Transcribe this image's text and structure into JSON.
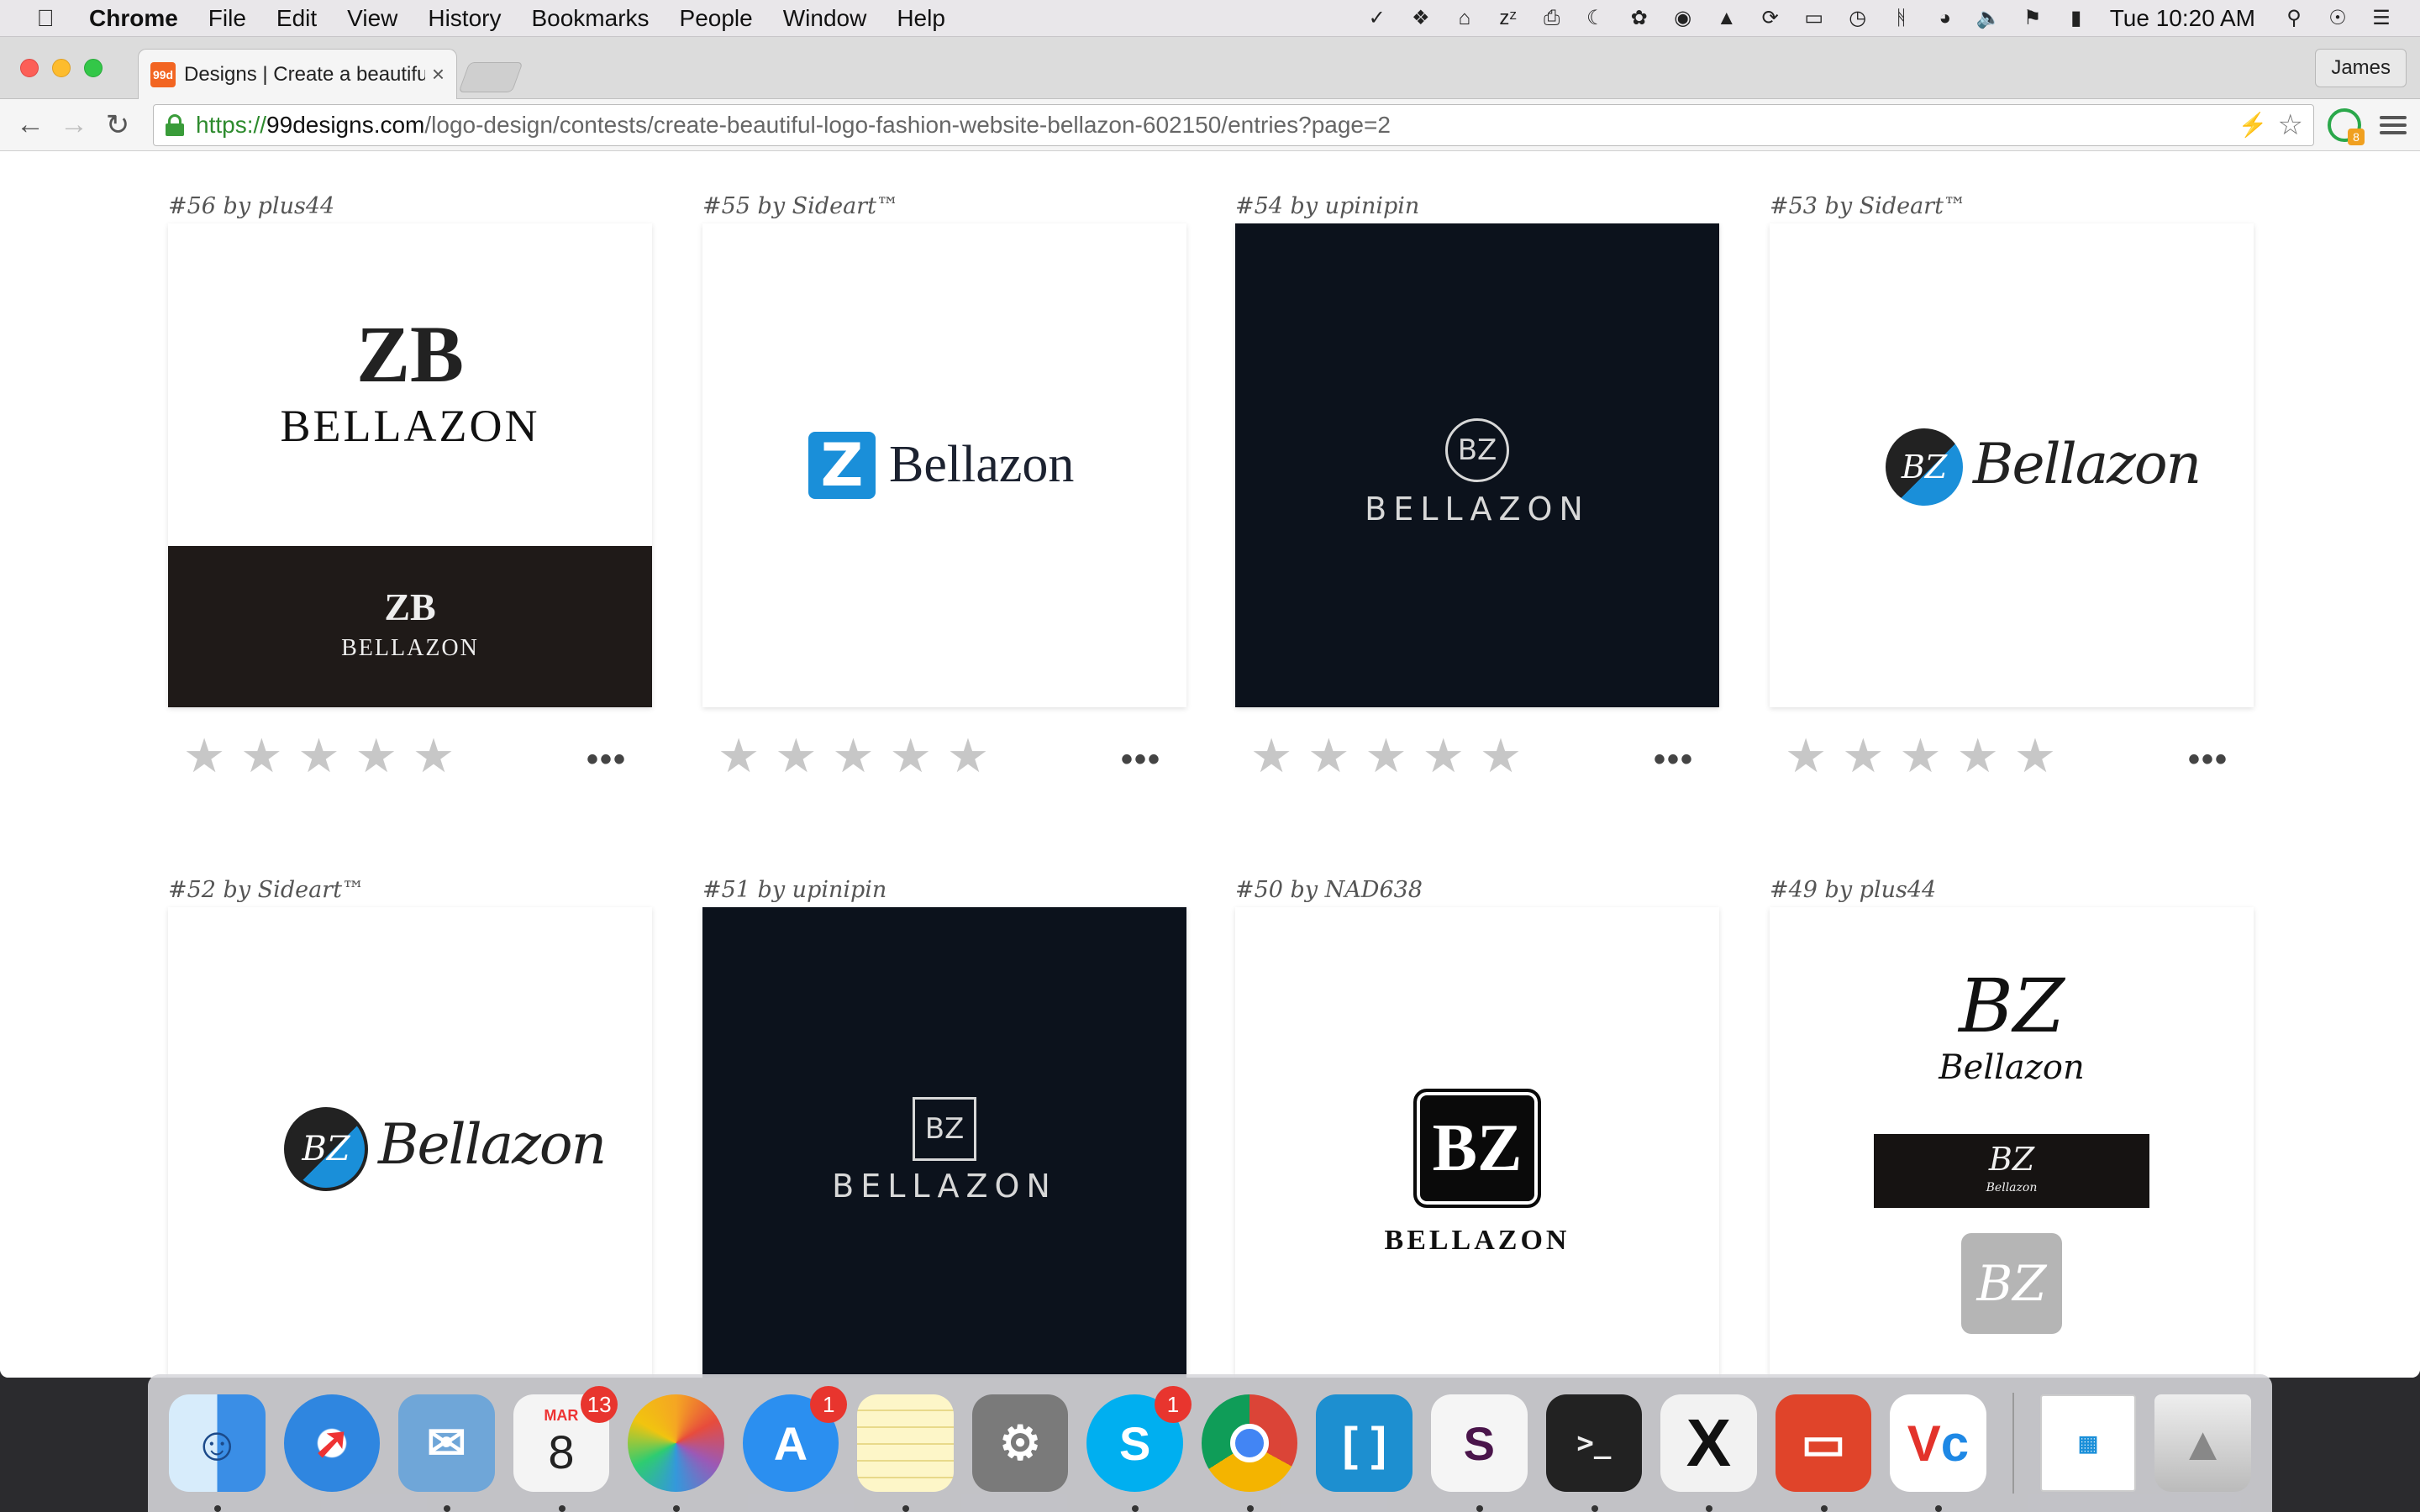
{
  "menubar": {
    "app_name": "Chrome",
    "menus": [
      "File",
      "Edit",
      "View",
      "History",
      "Bookmarks",
      "People",
      "Window",
      "Help"
    ],
    "clock": "Tue 10:20 AM"
  },
  "browser": {
    "tab_title": "Designs | Create a beautifu",
    "tab_favicon": "99d",
    "profile_name": "James",
    "url_scheme": "https://",
    "url_host": "99designs.com",
    "url_path": "/logo-design/contests/create-beautiful-logo-fashion-website-bellazon-602150/entries?page=2",
    "extension_badge": "8"
  },
  "entries": [
    {
      "caption": "#56 by plus44",
      "logo_text": "BELLAZON",
      "monogram": "ZB",
      "style": "serif-split"
    },
    {
      "caption": "#55 by Sideart™",
      "logo_text": "Bellazon",
      "monogram": "Z",
      "style": "blue-mark"
    },
    {
      "caption": "#54 by upinipin",
      "logo_text": "BELLAZON",
      "monogram": "BZ",
      "style": "dark-circle"
    },
    {
      "caption": "#53 by Sideart™",
      "logo_text": "Bellazon",
      "monogram": "BZ",
      "style": "script-badge"
    },
    {
      "caption": "#52 by Sideart™",
      "logo_text": "Bellazon",
      "monogram": "BZ",
      "style": "script-badge"
    },
    {
      "caption": "#51 by upinipin",
      "logo_text": "BELLAZON",
      "monogram": "BZ",
      "style": "dark-square"
    },
    {
      "caption": "#50 by NAD638",
      "logo_text": "BELLAZON",
      "monogram": "BZ",
      "style": "black-tile"
    },
    {
      "caption": "#49 by plus44",
      "logo_text": "Bellazon",
      "monogram": "BZ",
      "style": "handwritten"
    }
  ],
  "rating": {
    "stars": 5,
    "filled": 0
  },
  "dock": [
    {
      "name": "Finder",
      "color": "#3a8ee6"
    },
    {
      "name": "Safari",
      "color": "#2f86e0"
    },
    {
      "name": "Mail",
      "color": "#6fa6d8"
    },
    {
      "name": "Calendar",
      "color": "#f4f4f4",
      "month": "MAR",
      "day": "8",
      "badge": "13"
    },
    {
      "name": "Photos",
      "color": "#f7f7f7"
    },
    {
      "name": "App Store",
      "color": "#2b8ff0",
      "badge": "1"
    },
    {
      "name": "Notes",
      "color": "#f9e27a"
    },
    {
      "name": "System Preferences",
      "color": "#7a7a7a"
    },
    {
      "name": "Skype",
      "color": "#00aff0",
      "badge": "1"
    },
    {
      "name": "Chrome",
      "color": "#ffffff"
    },
    {
      "name": "Brackets",
      "color": "#1d8fd0"
    },
    {
      "name": "Slack",
      "color": "#f5f5f5"
    },
    {
      "name": "Terminal",
      "color": "#222222"
    },
    {
      "name": "X11",
      "color": "#f2f2f2"
    },
    {
      "name": "Remote Desktop",
      "color": "#e0442a"
    },
    {
      "name": "VNC Viewer",
      "color": "#ffffff"
    },
    {
      "name": "Document",
      "color": "#ffffff"
    },
    {
      "name": "Trash",
      "color": "#d8d8d8"
    }
  ]
}
